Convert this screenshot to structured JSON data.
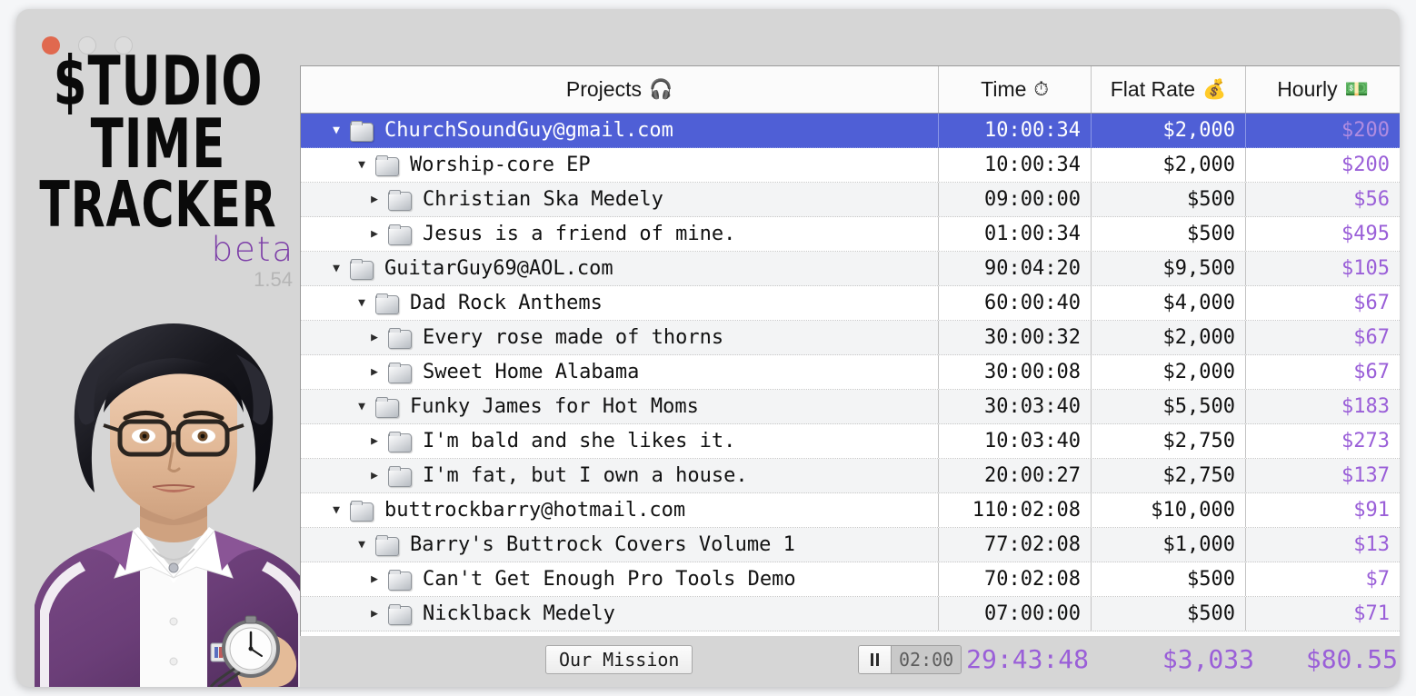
{
  "window": {
    "controls": [
      "close",
      "minimize",
      "maximize"
    ]
  },
  "brand": {
    "title_line1": "$TUDIO",
    "title_line2": "TIME",
    "title_line3": "TRACKER",
    "beta_label": "beta",
    "version": "1.54",
    "portrait_alt": "Illustrated woman with glasses in purple track jacket holding a stopwatch"
  },
  "table": {
    "headers": {
      "projects": "Projects",
      "projects_icon": "headphones-emoji",
      "projects_emoji": "🎧",
      "time": "Time",
      "time_icon": "stopwatch-emoji",
      "time_emoji": "⏱",
      "flat_rate": "Flat Rate",
      "flat_rate_icon": "money-bag-emoji",
      "flat_rate_emoji": "💰",
      "hourly": "Hourly",
      "hourly_icon": "dollar-banknote-emoji",
      "hourly_emoji": "💵"
    },
    "rows": [
      {
        "name": "ChurchSoundGuy@gmail.com",
        "level": 0,
        "expanded": true,
        "selected": true,
        "time": "10:00:34",
        "flat": "$2,000",
        "hourly": "$200"
      },
      {
        "name": "Worship-core EP",
        "level": 1,
        "expanded": true,
        "selected": false,
        "time": "10:00:34",
        "flat": "$2,000",
        "hourly": "$200"
      },
      {
        "name": "Christian Ska Medely",
        "level": 2,
        "expanded": false,
        "selected": false,
        "time": "09:00:00",
        "flat": "$500",
        "hourly": "$56"
      },
      {
        "name": "Jesus is a friend of mine.",
        "level": 2,
        "expanded": false,
        "selected": false,
        "time": "01:00:34",
        "flat": "$500",
        "hourly": "$495"
      },
      {
        "name": "GuitarGuy69@AOL.com",
        "level": 0,
        "expanded": true,
        "selected": false,
        "time": "90:04:20",
        "flat": "$9,500",
        "hourly": "$105"
      },
      {
        "name": "Dad Rock Anthems",
        "level": 1,
        "expanded": true,
        "selected": false,
        "time": "60:00:40",
        "flat": "$4,000",
        "hourly": "$67"
      },
      {
        "name": "Every rose made of thorns",
        "level": 2,
        "expanded": false,
        "selected": false,
        "time": "30:00:32",
        "flat": "$2,000",
        "hourly": "$67"
      },
      {
        "name": "Sweet Home Alabama",
        "level": 2,
        "expanded": false,
        "selected": false,
        "time": "30:00:08",
        "flat": "$2,000",
        "hourly": "$67"
      },
      {
        "name": "Funky James for Hot Moms",
        "level": 1,
        "expanded": true,
        "selected": false,
        "time": "30:03:40",
        "flat": "$5,500",
        "hourly": "$183"
      },
      {
        "name": "I'm bald and she likes it.",
        "level": 2,
        "expanded": false,
        "selected": false,
        "time": "10:03:40",
        "flat": "$2,750",
        "hourly": "$273"
      },
      {
        "name": "I'm fat, but I own a house.",
        "level": 2,
        "expanded": false,
        "selected": false,
        "time": "20:00:27",
        "flat": "$2,750",
        "hourly": "$137"
      },
      {
        "name": "buttrockbarry@hotmail.com",
        "level": 0,
        "expanded": true,
        "selected": false,
        "time": "110:02:08",
        "flat": "$10,000",
        "hourly": "$91"
      },
      {
        "name": "Barry's Buttrock Covers Volume 1",
        "level": 1,
        "expanded": true,
        "selected": false,
        "time": "77:02:08",
        "flat": "$1,000",
        "hourly": "$13"
      },
      {
        "name": "Can't Get Enough Pro Tools Demo",
        "level": 2,
        "expanded": false,
        "selected": false,
        "time": "70:02:08",
        "flat": "$500",
        "hourly": "$7"
      },
      {
        "name": "Nicklback Medely",
        "level": 2,
        "expanded": false,
        "selected": false,
        "time": "07:00:00",
        "flat": "$500",
        "hourly": "$71"
      }
    ]
  },
  "bottom": {
    "mission_button": "Our Mission",
    "pause_icon": "pause-icon",
    "timer_value": "02:00",
    "total_time": "29:43:48",
    "total_flat": "$3,033",
    "total_hourly": "$80.55"
  },
  "colors": {
    "selection_blue": "#4f5fd6",
    "accent_purple": "#9a5fd8",
    "beta_purple": "#7d3fa8",
    "window_chrome": "#d6d6d6",
    "close_button": "#e0694f"
  }
}
